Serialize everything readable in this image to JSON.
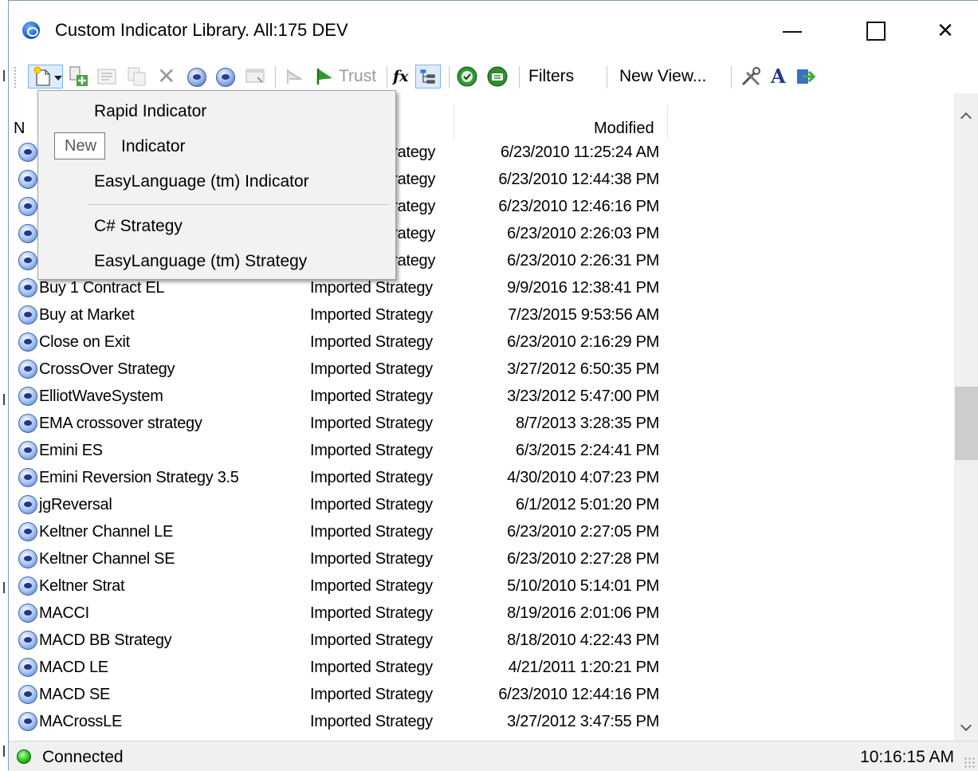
{
  "window": {
    "title": "Custom Indicator Library. All:175 DEV"
  },
  "toolbar": {
    "trust_label": "Trust",
    "filters_label": "Filters",
    "new_view_label": "New View..."
  },
  "list": {
    "col_modified": "Modified",
    "col_name_partial": "N",
    "rows": [
      {
        "name": "",
        "type": "trategy",
        "modified": "6/23/2010 11:25:24 AM"
      },
      {
        "name": "",
        "type": "trategy",
        "modified": "6/23/2010 12:44:38 PM"
      },
      {
        "name": "",
        "type": "trategy",
        "modified": "6/23/2010 12:46:16 PM"
      },
      {
        "name": "",
        "type": "trategy",
        "modified": "6/23/2010 2:26:03 PM"
      },
      {
        "name": "",
        "type": "trategy",
        "modified": "6/23/2010 2:26:31 PM"
      },
      {
        "name": "Buy 1 Contract EL",
        "type": "Imported Strategy",
        "modified": "9/9/2016 12:38:41 PM"
      },
      {
        "name": "Buy at Market",
        "type": "Imported Strategy",
        "modified": "7/23/2015 9:53:56 AM"
      },
      {
        "name": "Close on Exit",
        "type": "Imported Strategy",
        "modified": "6/23/2010 2:16:29 PM"
      },
      {
        "name": "CrossOver Strategy",
        "type": "Imported Strategy",
        "modified": "3/27/2012 6:50:35 PM"
      },
      {
        "name": "ElliotWaveSystem",
        "type": "Imported Strategy",
        "modified": "3/23/2012 5:47:00 PM"
      },
      {
        "name": "EMA crossover strategy",
        "type": "Imported Strategy",
        "modified": "8/7/2013 3:28:35 PM"
      },
      {
        "name": "Emini ES",
        "type": "Imported Strategy",
        "modified": "6/3/2015 2:24:41 PM"
      },
      {
        "name": "Emini Reversion Strategy 3.5",
        "type": "Imported Strategy",
        "modified": "4/30/2010 4:07:23 PM"
      },
      {
        "name": "jgReversal",
        "type": "Imported Strategy",
        "modified": "6/1/2012 5:01:20 PM"
      },
      {
        "name": "Keltner Channel LE",
        "type": "Imported Strategy",
        "modified": "6/23/2010 2:27:05 PM"
      },
      {
        "name": "Keltner Channel SE",
        "type": "Imported Strategy",
        "modified": "6/23/2010 2:27:28 PM"
      },
      {
        "name": "Keltner Strat",
        "type": "Imported Strategy",
        "modified": "5/10/2010 5:14:01 PM"
      },
      {
        "name": "MACCI",
        "type": "Imported Strategy",
        "modified": "8/19/2016 2:01:06 PM"
      },
      {
        "name": "MACD BB Strategy",
        "type": "Imported Strategy",
        "modified": "8/18/2010 4:22:43 PM"
      },
      {
        "name": "MACD LE",
        "type": "Imported Strategy",
        "modified": "4/21/2011 1:20:21 PM"
      },
      {
        "name": "MACD SE",
        "type": "Imported Strategy",
        "modified": "6/23/2010 12:44:16 PM"
      },
      {
        "name": "MACrossLE",
        "type": "Imported Strategy",
        "modified": "3/27/2012 3:47:55 PM"
      }
    ]
  },
  "menu": {
    "items": [
      "Rapid Indicator",
      "Indicator",
      "EasyLanguage (tm) Indicator",
      "C# Strategy",
      "EasyLanguage (tm) Strategy"
    ]
  },
  "tooltip": {
    "text": "New"
  },
  "status": {
    "connection": "Connected",
    "time": "10:16:15 AM"
  },
  "colors": {
    "accent": "#3b62b8",
    "status_ok": "#26c21f"
  }
}
